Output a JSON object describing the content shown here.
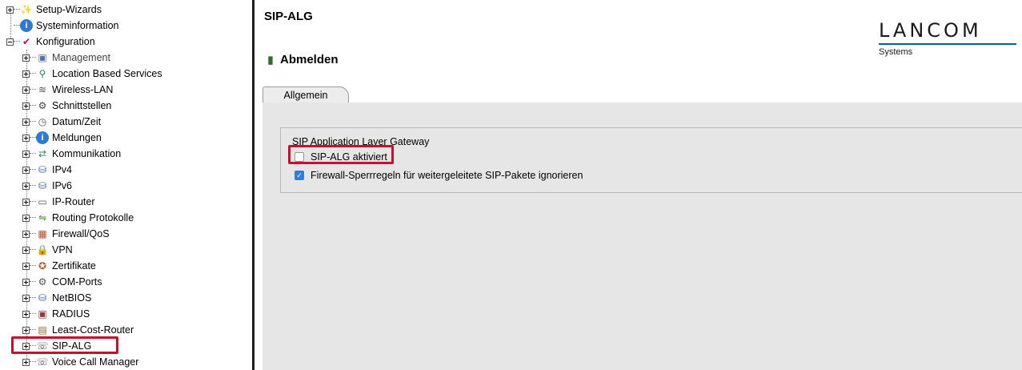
{
  "tree": {
    "top": [
      {
        "label": "Setup-Wizards",
        "icon": "magic-wand-icon",
        "glyph": "✨",
        "expander": "plus"
      },
      {
        "label": "Systeminformation",
        "icon": "info-icon",
        "glyph": "i",
        "expander": "none"
      },
      {
        "label": "Konfiguration",
        "icon": "config-icon",
        "glyph": "✔",
        "expander": "minus"
      }
    ],
    "children": [
      {
        "label": "Management",
        "icon": "management-icon",
        "glyph": "▣"
      },
      {
        "label": "Location Based Services",
        "icon": "location-pin-icon",
        "glyph": "⚲"
      },
      {
        "label": "Wireless-LAN",
        "icon": "wireless-icon",
        "glyph": "≋"
      },
      {
        "label": "Schnittstellen",
        "icon": "interfaces-icon",
        "glyph": "⚙"
      },
      {
        "label": "Datum/Zeit",
        "icon": "clock-icon",
        "glyph": "◷"
      },
      {
        "label": "Meldungen",
        "icon": "info-icon",
        "glyph": "i"
      },
      {
        "label": "Kommunikation",
        "icon": "communication-icon",
        "glyph": "⇄"
      },
      {
        "label": "IPv4",
        "icon": "network-icon",
        "glyph": "⛁"
      },
      {
        "label": "IPv6",
        "icon": "network-icon",
        "glyph": "⛁"
      },
      {
        "label": "IP-Router",
        "icon": "router-icon",
        "glyph": "▭"
      },
      {
        "label": "Routing Protokolle",
        "icon": "routing-icon",
        "glyph": "⇋"
      },
      {
        "label": "Firewall/QoS",
        "icon": "firewall-icon",
        "glyph": "▦"
      },
      {
        "label": "VPN",
        "icon": "lock-icon",
        "glyph": "🔒"
      },
      {
        "label": "Zertifikate",
        "icon": "certificate-icon",
        "glyph": "✪"
      },
      {
        "label": "COM-Ports",
        "icon": "com-port-icon",
        "glyph": "⚙"
      },
      {
        "label": "NetBIOS",
        "icon": "netbios-icon",
        "glyph": "⛁"
      },
      {
        "label": "RADIUS",
        "icon": "radius-icon",
        "glyph": "▣"
      },
      {
        "label": "Least-Cost-Router",
        "icon": "least-cost-router-icon",
        "glyph": "▤"
      },
      {
        "label": "SIP-ALG",
        "icon": "phone-icon",
        "glyph": "☏"
      },
      {
        "label": "Voice Call Manager",
        "icon": "phone-icon",
        "glyph": "☏"
      }
    ]
  },
  "main": {
    "title": "SIP-ALG",
    "logout_label": "Abmelden",
    "tab_label": "Allgemein",
    "group_title": "SIP Application Layer Gateway",
    "checkbox_sip_alg": {
      "label": "SIP-ALG aktiviert",
      "checked": false
    },
    "checkbox_firewall": {
      "label": "Firewall-Sperrregeln für weitergeleitete SIP-Pakete ignorieren",
      "checked": true
    }
  },
  "logo": {
    "name": "LANCOM",
    "sub": "Systems"
  },
  "colors": {
    "highlight": "#c8102e",
    "checkbox_checked": "#2f7fd6",
    "logo_bar": "#0a5e8a"
  }
}
